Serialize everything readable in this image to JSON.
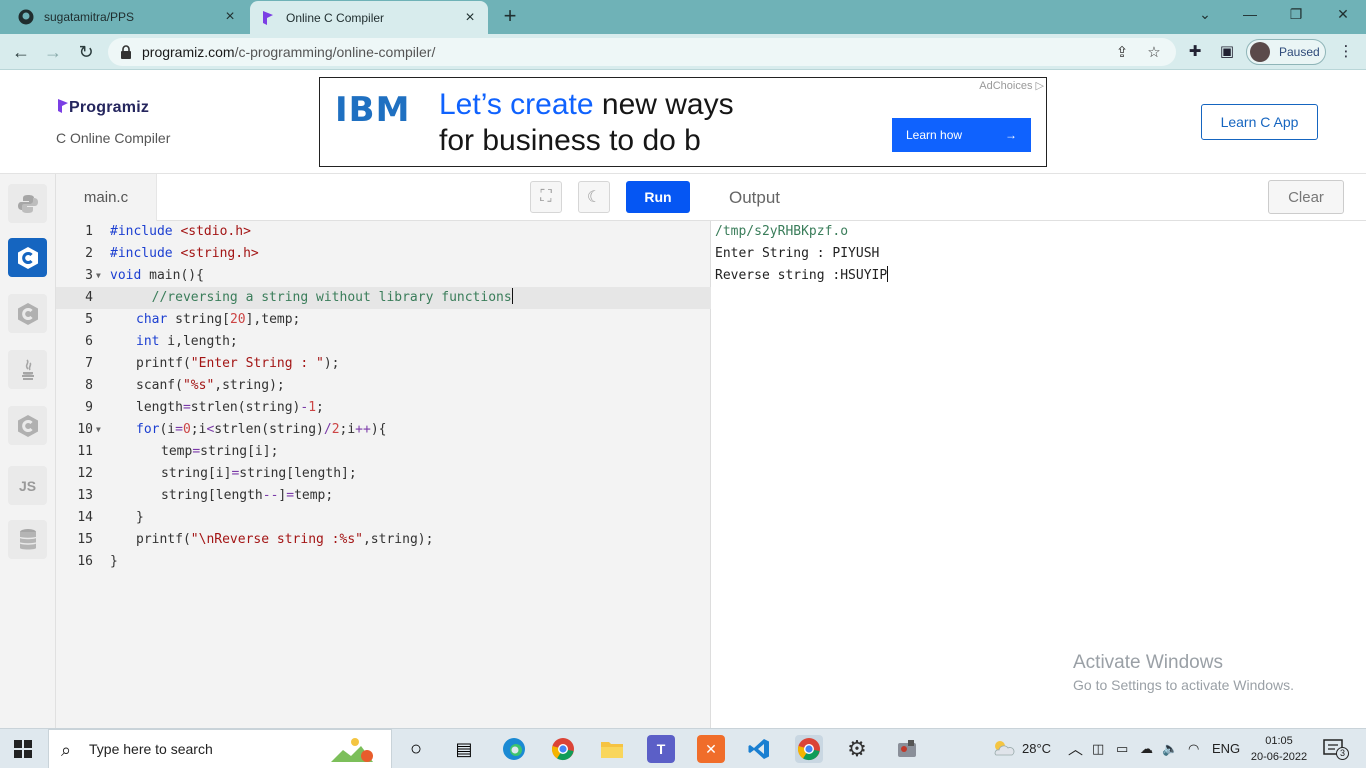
{
  "browser": {
    "tabs": [
      {
        "title": "sugatamitra/PPS",
        "active": false
      },
      {
        "title": "Online C Compiler",
        "active": true
      }
    ],
    "url_host": "programiz.com",
    "url_path": "/c-programming/online-compiler/",
    "profile_status": "Paused"
  },
  "header": {
    "logo": "Programiz",
    "subtitle": "C Online Compiler",
    "learn_button": "Learn C App"
  },
  "ad": {
    "brand": "IBM",
    "headline_highlight": "Let’s create",
    "headline_rest": " new ways",
    "line2": "for business to do b",
    "cta": "Learn how",
    "adchoices": "AdChoices"
  },
  "sidebar": {
    "languages": [
      {
        "name": "python",
        "label": "",
        "active": false
      },
      {
        "name": "c",
        "label": "C",
        "active": true
      },
      {
        "name": "cpp",
        "label": "C",
        "active": false
      },
      {
        "name": "java",
        "label": "",
        "active": false
      },
      {
        "name": "csharp",
        "label": "C",
        "active": false
      },
      {
        "name": "javascript",
        "label": "JS",
        "active": false
      },
      {
        "name": "sql",
        "label": "",
        "active": false
      }
    ]
  },
  "editor": {
    "filename": "main.c",
    "run_label": "Run",
    "lines": [
      "1",
      "2",
      "3",
      "4",
      "5",
      "6",
      "7",
      "8",
      "9",
      "10",
      "11",
      "12",
      "13",
      "14",
      "15",
      "16"
    ],
    "code": {
      "l1a": "#include ",
      "l1b": "<stdio.h>",
      "l2a": "#include ",
      "l2b": "<string.h>",
      "l3a": "void",
      "l3b": " main(){",
      "l4": "  //reversing a string without library functions",
      "l5a": "char",
      "l5b": " string[",
      "l5c": "20",
      "l5d": "],temp;",
      "l6a": "int",
      "l6b": " i,length;",
      "l7a": "printf(",
      "l7b": "\"Enter String : \"",
      "l7c": ");",
      "l8a": "scanf(",
      "l8b": "\"%s\"",
      "l8c": ",string);",
      "l9a": "length",
      "l9b": "=",
      "l9c": "strlen(string)",
      "l9d": "-",
      "l9e": "1",
      "l9f": ";",
      "l10a": "for",
      "l10b": "(i",
      "l10c": "=",
      "l10d": "0",
      "l10e": ";i",
      "l10f": "<",
      "l10g": "strlen(string)",
      "l10h": "/",
      "l10i": "2",
      "l10j": ";i",
      "l10k": "++",
      "l10l": "){",
      "l11a": "temp",
      "l11b": "=",
      "l11c": "string[i];",
      "l12a": "string[i]",
      "l12b": "=",
      "l12c": "string[length];",
      "l13a": "string[length",
      "l13b": "--",
      "l13c": "]",
      "l13d": "=",
      "l13e": "temp;",
      "l14": "}",
      "l15a": "printf(",
      "l15b": "\"\\nReverse string :%s\"",
      "l15c": ",string);",
      "l16": "}"
    }
  },
  "output": {
    "title": "Output",
    "clear_label": "Clear",
    "lines": [
      "/tmp/s2yRHBKpzf.o",
      "Enter String : PIYUSH",
      "Reverse string :HSUYIP"
    ],
    "watermark_title": "Activate Windows",
    "watermark_sub": "Go to Settings to activate Windows."
  },
  "taskbar": {
    "search_placeholder": "Type here to search",
    "temperature": "28°C",
    "language": "ENG",
    "time": "01:05",
    "date": "20-06-2022",
    "notifications": "3"
  }
}
